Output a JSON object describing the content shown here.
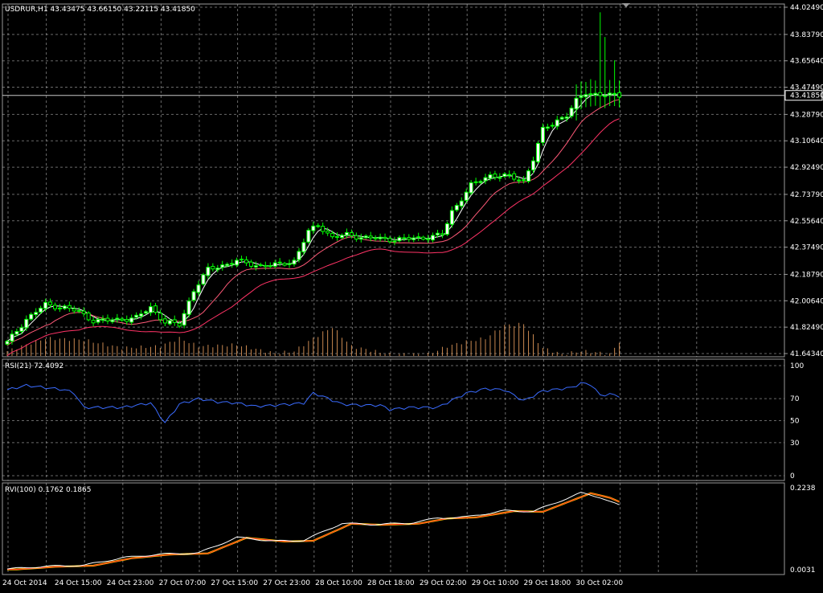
{
  "chart_data": [
    {
      "type": "candlestick",
      "panel": "main",
      "title": "USDRUR,H1",
      "ohlc_readout": [
        "43.43475",
        "43.66150",
        "43.22115",
        "43.41850"
      ],
      "ylim": [
        41.6434,
        44.0249
      ],
      "y_ticks": [
        "44.02490",
        "43.83790",
        "43.65640",
        "43.47490",
        "43.28790",
        "43.10640",
        "42.92490",
        "42.73790",
        "42.55640",
        "42.37490",
        "42.18790",
        "42.00640",
        "41.82490",
        "41.64340"
      ],
      "current_price_label": "43.41850",
      "current_price": 43.4185,
      "x_ticks": [
        "24 Oct 2014",
        "24 Oct 15:00",
        "24 Oct 23:00",
        "27 Oct 07:00",
        "27 Oct 15:00",
        "27 Oct 23:00",
        "28 Oct 10:00",
        "28 Oct 18:00",
        "29 Oct 02:00",
        "29 Oct 10:00",
        "29 Oct 18:00",
        "30 Oct 02:00"
      ],
      "grid": true,
      "colors": {
        "bull_candle": "#00ff00",
        "bear_candle": "#00ff00",
        "bull_body": "#ffffff",
        "bear_body": "#000000",
        "ma_fast": "#ffffff",
        "ma_slow": "#ff5a78",
        "ma_slower": "#ff3366",
        "volume": "#c88850"
      },
      "close_anchors": [
        [
          0,
          41.72
        ],
        [
          4,
          41.88
        ],
        [
          8,
          41.98
        ],
        [
          12,
          41.96
        ],
        [
          15,
          41.93
        ],
        [
          18,
          41.87
        ],
        [
          21,
          41.87
        ],
        [
          24,
          41.88
        ],
        [
          27,
          41.89
        ],
        [
          30,
          41.96
        ],
        [
          33,
          41.86
        ],
        [
          36,
          41.84
        ],
        [
          39,
          42.08
        ],
        [
          42,
          42.22
        ],
        [
          45,
          42.25
        ],
        [
          48,
          42.28
        ],
        [
          52,
          42.25
        ],
        [
          56,
          42.25
        ],
        [
          60,
          42.28
        ],
        [
          63,
          42.48
        ],
        [
          65,
          42.53
        ],
        [
          68,
          42.44
        ],
        [
          71,
          42.46
        ],
        [
          75,
          42.44
        ],
        [
          79,
          42.43
        ],
        [
          83,
          42.43
        ],
        [
          87,
          42.44
        ],
        [
          91,
          42.46
        ],
        [
          93,
          42.62
        ],
        [
          97,
          42.8
        ],
        [
          101,
          42.87
        ],
        [
          105,
          42.86
        ],
        [
          108,
          42.83
        ],
        [
          110,
          42.98
        ],
        [
          112,
          43.18
        ],
        [
          115,
          43.25
        ],
        [
          117,
          43.28
        ],
        [
          119,
          43.38
        ],
        [
          121,
          43.44
        ],
        [
          124,
          43.42
        ],
        [
          127,
          43.42
        ],
        [
          128,
          43.42
        ]
      ],
      "volume_anchors": [
        [
          0,
          0.15
        ],
        [
          8,
          0.55
        ],
        [
          16,
          0.5
        ],
        [
          24,
          0.25
        ],
        [
          32,
          0.3
        ],
        [
          36,
          0.55
        ],
        [
          40,
          0.3
        ],
        [
          48,
          0.35
        ],
        [
          56,
          0.08
        ],
        [
          60,
          0.15
        ],
        [
          64,
          0.55
        ],
        [
          68,
          0.9
        ],
        [
          72,
          0.3
        ],
        [
          80,
          0.05
        ],
        [
          88,
          0.05
        ],
        [
          92,
          0.3
        ],
        [
          96,
          0.45
        ],
        [
          100,
          0.55
        ],
        [
          104,
          0.95
        ],
        [
          108,
          1.0
        ],
        [
          112,
          0.25
        ],
        [
          116,
          0.05
        ],
        [
          120,
          0.15
        ],
        [
          124,
          0.1
        ],
        [
          126,
          0.05
        ],
        [
          128,
          0.45
        ]
      ]
    },
    {
      "type": "line",
      "panel": "rsi",
      "title": "RSI(21) 72.4092",
      "ylim": [
        0,
        100
      ],
      "y_ticks": [
        "100",
        "70",
        "50",
        "30",
        "0"
      ],
      "grid": true,
      "colors": {
        "line": "#3a6bff"
      },
      "anchors": [
        [
          0,
          78
        ],
        [
          4,
          82
        ],
        [
          8,
          80
        ],
        [
          12,
          78
        ],
        [
          14,
          75
        ],
        [
          16,
          62
        ],
        [
          20,
          62
        ],
        [
          24,
          62
        ],
        [
          30,
          66
        ],
        [
          33,
          48
        ],
        [
          36,
          65
        ],
        [
          40,
          70
        ],
        [
          44,
          67
        ],
        [
          48,
          66
        ],
        [
          52,
          63
        ],
        [
          56,
          64
        ],
        [
          62,
          66
        ],
        [
          64,
          75
        ],
        [
          66,
          72
        ],
        [
          70,
          65
        ],
        [
          74,
          64
        ],
        [
          78,
          64
        ],
        [
          80,
          60
        ],
        [
          84,
          62
        ],
        [
          90,
          62
        ],
        [
          96,
          75
        ],
        [
          100,
          79
        ],
        [
          104,
          78
        ],
        [
          108,
          68
        ],
        [
          112,
          77
        ],
        [
          114,
          78
        ],
        [
          118,
          80
        ],
        [
          120,
          84
        ],
        [
          122,
          83
        ],
        [
          124,
          73
        ],
        [
          126,
          74
        ],
        [
          128,
          72.4
        ]
      ]
    },
    {
      "type": "line",
      "panel": "rvi",
      "title": "RVI(100) 0.1762 0.1865",
      "ylim": [
        0.0031,
        0.2238
      ],
      "y_ticks": [
        "0.2238",
        "0.0031"
      ],
      "grid": true,
      "colors": {
        "main": "#ffffff",
        "signal": "#ff2020",
        "fill": "#ffd400"
      },
      "anchors": [
        [
          0,
          0.005
        ],
        [
          8,
          0.012
        ],
        [
          16,
          0.015
        ],
        [
          24,
          0.035
        ],
        [
          32,
          0.045
        ],
        [
          40,
          0.048
        ],
        [
          48,
          0.09
        ],
        [
          56,
          0.08
        ],
        [
          62,
          0.082
        ],
        [
          70,
          0.128
        ],
        [
          76,
          0.125
        ],
        [
          84,
          0.128
        ],
        [
          90,
          0.142
        ],
        [
          96,
          0.145
        ],
        [
          104,
          0.162
        ],
        [
          110,
          0.16
        ],
        [
          116,
          0.19
        ],
        [
          120,
          0.21
        ],
        [
          124,
          0.198
        ],
        [
          128,
          0.176
        ]
      ]
    }
  ]
}
